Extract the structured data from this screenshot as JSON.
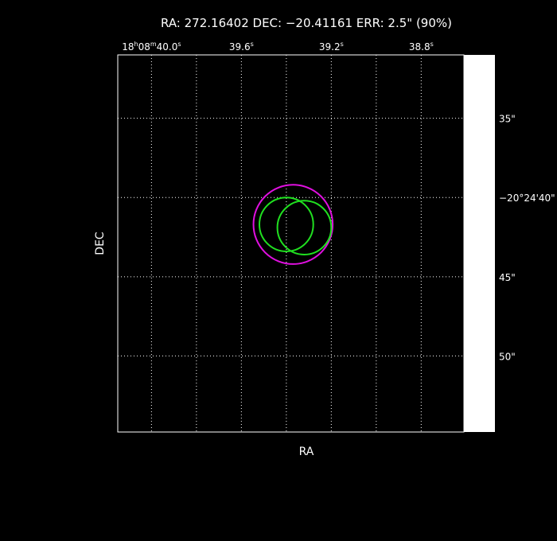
{
  "header": {
    "title": "RA: 272.16402   DEC: −20.41161   ERR: 2.5\" (90%)"
  },
  "chart_data": {
    "type": "scatter",
    "title": "RA: 272.16402   DEC: −20.41161   ERR: 2.5\" (90%)",
    "xlabel": "RA",
    "ylabel": "DEC",
    "xlim_ra_sec": [
      40.15,
      38.61
    ],
    "ylim_dec_arcsec": [
      31.0,
      54.8
    ],
    "x_ticks": [
      {
        "value": 40.0,
        "main": "18",
        "sup1": "h",
        "mid": "08",
        "sup2": "m",
        "tail": "40.0",
        "sup3": "s"
      },
      {
        "value": 39.6,
        "main": "39.6",
        "sup1": "s"
      },
      {
        "value": 39.2,
        "main": "39.2",
        "sup1": "s"
      },
      {
        "value": 38.8,
        "main": "38.8",
        "sup1": "s"
      }
    ],
    "x_gridlines": [
      40.0,
      39.8,
      39.6,
      39.4,
      39.2,
      39.0,
      38.8
    ],
    "y_ticks": [
      {
        "value": 35,
        "label": "35\""
      },
      {
        "value": 40,
        "label": "−20°24'40\""
      },
      {
        "value": 45,
        "label": "45\""
      },
      {
        "value": 50,
        "label": "50\""
      }
    ],
    "y_gridlines": [
      35,
      40,
      45,
      50
    ],
    "grid": true,
    "circles": [
      {
        "ra_sec": 39.37,
        "dec_arcsec": 41.7,
        "radius_arcsec": 2.5,
        "color": "#e010e0"
      },
      {
        "ra_sec": 39.4,
        "dec_arcsec": 41.7,
        "radius_arcsec": 1.7,
        "color": "#20e020"
      },
      {
        "ra_sec": 39.32,
        "dec_arcsec": 41.9,
        "radius_arcsec": 1.7,
        "color": "#20e020"
      }
    ],
    "colors": {
      "background": "#000000",
      "frame": "#ffffff",
      "grid": "#ffffff",
      "side_panel": "#ffffff"
    }
  }
}
